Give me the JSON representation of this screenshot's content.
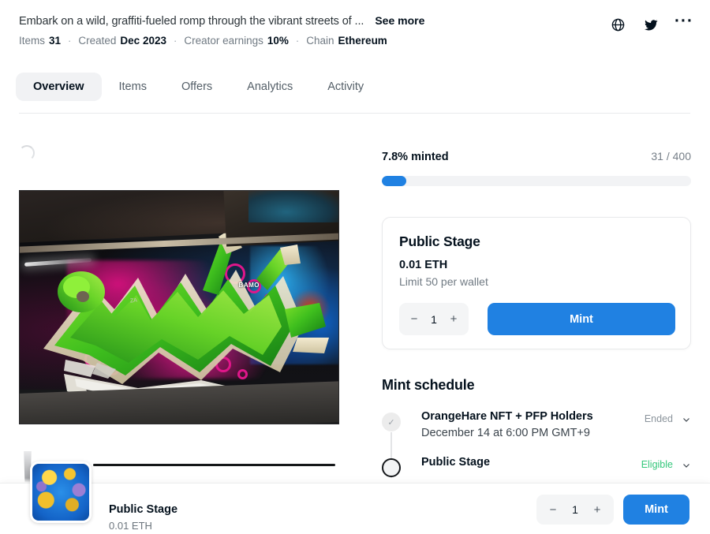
{
  "header": {
    "description": "Embark on a wild, graffiti-fueled romp through the vibrant streets of ...",
    "see_more_label": "See more",
    "meta": {
      "items_label": "Items",
      "items_value": "31",
      "created_label": "Created",
      "created_value": "Dec 2023",
      "earnings_label": "Creator earnings",
      "earnings_value": "10%",
      "chain_label": "Chain",
      "chain_value": "Ethereum",
      "separator": "·"
    },
    "icons": {
      "website": "globe-icon",
      "twitter": "twitter-icon",
      "more": "more-horizontal-icon",
      "more_glyph": "···"
    }
  },
  "tabs": [
    {
      "label": "Overview",
      "active": true
    },
    {
      "label": "Items",
      "active": false
    },
    {
      "label": "Offers",
      "active": false
    },
    {
      "label": "Analytics",
      "active": false
    },
    {
      "label": "Activity",
      "active": false
    }
  ],
  "artwork": {
    "alt_name": "graffiti-mural-image",
    "tag_text": "BAMO",
    "tag_text_2": "ZA"
  },
  "mint_progress": {
    "percent_label": "7.8% minted",
    "count_label": "31 / 400",
    "fill_percent": 7.8,
    "fill_color": "#2081e2",
    "track_color": "#f2f3f5"
  },
  "mint_card": {
    "stage_title": "Public Stage",
    "price": "0.01 ETH",
    "limit": "Limit 50 per wallet",
    "quantity": "1",
    "minus_label": "−",
    "plus_label": "+",
    "mint_label": "Mint"
  },
  "mint_schedule": {
    "title": "Mint schedule",
    "rows": [
      {
        "name": "OrangeHare NFT + PFP Holders",
        "time": "December 14 at 6:00 PM GMT+9",
        "status": "Ended",
        "status_color": "#8b949c",
        "state": "done",
        "marker_glyph": "✓"
      },
      {
        "name": "Public Stage",
        "time": "",
        "status": "Eligible",
        "status_color": "#34c77b",
        "state": "open",
        "marker_glyph": ""
      }
    ]
  },
  "bottom_bar": {
    "thumbnail_name": "collection-thumbnail",
    "stage_name": "Public Stage",
    "price": "0.01 ETH",
    "quantity": "1",
    "minus_label": "−",
    "plus_label": "+",
    "mint_label": "Mint"
  }
}
